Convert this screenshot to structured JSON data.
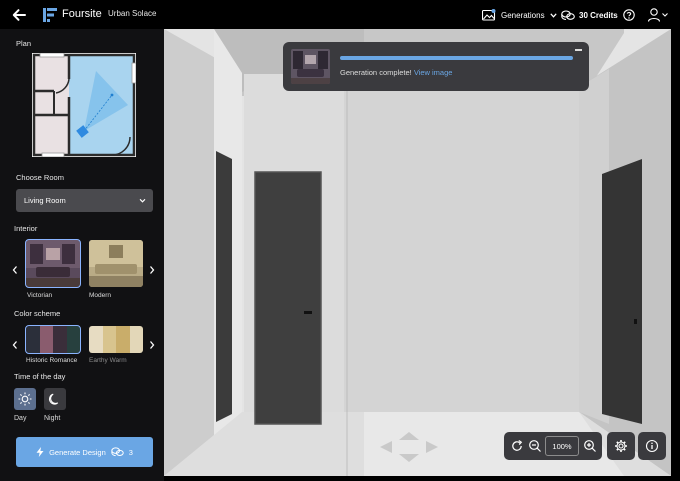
{
  "header": {
    "brand": "Foursite",
    "project": "Urban Solace",
    "generations_label": "Generations",
    "credits_label": "30 Credits"
  },
  "sidebar": {
    "plan_label": "Plan",
    "choose_room_label": "Choose Room",
    "room_selected": "Living Room",
    "interior_label": "Interior",
    "interiors": [
      {
        "name": "Victorian",
        "selected": true
      },
      {
        "name": "Modern",
        "selected": false
      }
    ],
    "color_scheme_label": "Color scheme",
    "color_schemes": [
      {
        "name": "Historic Romance",
        "selected": true,
        "colors": [
          "#2b2f3a",
          "#8a5c6e",
          "#3a2e3a",
          "#27403e"
        ]
      },
      {
        "name": "Earthy Warm",
        "selected": false,
        "colors": [
          "#e7dcc2",
          "#d8c48e",
          "#c9ad6a",
          "#e3d7b8"
        ]
      }
    ],
    "time_label": "Time of the day",
    "times": [
      {
        "name": "Day",
        "selected": true
      },
      {
        "name": "Night",
        "selected": false
      }
    ],
    "generate_label": "Generate Design",
    "generate_cost": "3"
  },
  "notification": {
    "message": "Generation complete!",
    "link": "View image"
  },
  "viewer": {
    "zoom": "100%"
  },
  "colors": {
    "accent": "#6aa6e4",
    "sidebar_bg": "#111113",
    "panel": "#3a3a3e"
  }
}
